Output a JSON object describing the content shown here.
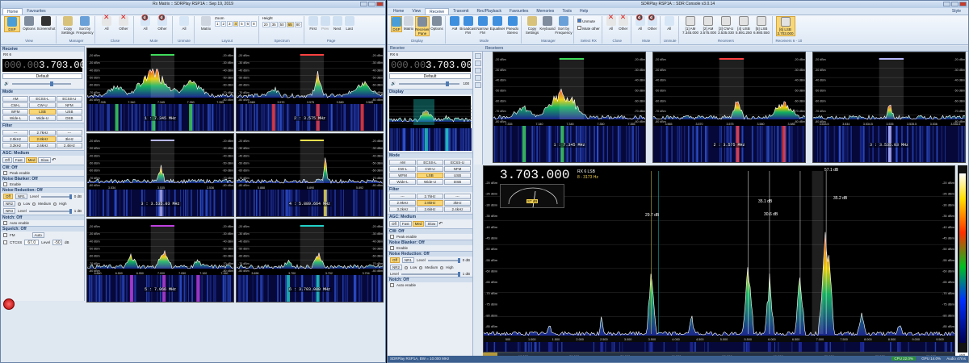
{
  "left_window": {
    "title": "Rx Matrix :: SDRPlay RSP1A :: Sep 19, 2019",
    "tabs": [
      "Home",
      "Favourites"
    ],
    "ribbon": {
      "groups": [
        {
          "caption": "View",
          "buttons": [
            "DSP",
            "Options",
            "Screenshot"
          ]
        },
        {
          "caption": "Manager",
          "buttons": [
            "Copy Settings",
            "Sort by Frequency"
          ]
        },
        {
          "caption": "Close",
          "buttons": [
            "All",
            "Other"
          ]
        },
        {
          "caption": "Mute",
          "buttons": [
            "All",
            "Other"
          ]
        },
        {
          "caption": "Unmute",
          "buttons": [
            "All"
          ]
        },
        {
          "caption": "Layout",
          "buttons": [
            "Matrix"
          ],
          "zoom_label": "Zoom",
          "zoom_values": [
            "1",
            "2",
            "3",
            "4",
            "5",
            "6",
            "8"
          ]
        },
        {
          "caption": "Spectrum",
          "height_label": "Height",
          "height_values": [
            "20",
            "35",
            "50",
            "65",
            "80"
          ]
        },
        {
          "caption": "Page",
          "buttons": [
            "First",
            "Prev",
            "Next",
            "Last"
          ]
        }
      ]
    },
    "panel": {
      "receive_label": "Receive",
      "rx_header": "RX 6",
      "freq_dim": "000.00",
      "freq_main": "3.703.000",
      "preset": "Default",
      "mode_label": "Mode",
      "modes": [
        "AM",
        "ECSS-L",
        "ECSS-U",
        "CW-L",
        "CW-U",
        "NFM",
        "WFM",
        "LSB",
        "USB",
        "Wide-L",
        "Wide-U",
        "DSB"
      ],
      "filter_label": "Filter",
      "filters": [
        "---",
        "2.7kHz",
        "---",
        "2.9kHz",
        "2.8kHz",
        "3kHz",
        "3.2kHz",
        "2.6kHz",
        "2.4kHz"
      ],
      "agc_label": "AGC: Medium",
      "agc_buttons": [
        "Off",
        "Fast",
        "Med",
        "Slow"
      ],
      "cw_off": "CW: Off",
      "peak_enable": "Peak enable",
      "noise_blanker": "Noise Blanker: Off",
      "enable": "Enable",
      "noise_reduction": "Noise Reduction: Off",
      "nr_off": "Off",
      "nr1": "NR1",
      "nr2": "NR2",
      "nr3": "NR3",
      "level": "Level",
      "low": "Low",
      "medium": "Medium",
      "high": "High",
      "db1": "0 dB",
      "db2": "1 dB",
      "notch_off": "Notch: Off",
      "auto_enable": "Auto enable",
      "squelch_off": "Squelch: Off",
      "fm": "FM",
      "ctcss": "CTCSS",
      "ctcss_value": "67.0",
      "squelch_level": "Level",
      "squelch_db": "dB"
    },
    "cells": [
      {
        "rx": "1",
        "freq": "1 : 7.345 MHz",
        "hdr_f": "8 - 7173 Hz",
        "ticks": [
          "7.335",
          "7.340",
          "7.345",
          "7.350",
          "7.355"
        ]
      },
      {
        "rx": "2",
        "freq": "2 : 3.575 MHz",
        "hdr_f": "8 - 3173 Hz",
        "ticks": [
          "3.565",
          "3.570",
          "3.575",
          "3.580",
          "3.585"
        ]
      },
      {
        "rx": "3",
        "freq": "3 : 3.535.03 MHz",
        "hdr_f": "8 - 3173 Hz",
        "ticks": [
          "3.534",
          "3.535",
          "3.536"
        ]
      },
      {
        "rx": "4",
        "freq": "4 : 5.889.664 MHz",
        "hdr_f": "8 - 3173 Hz",
        "ticks": [
          "5.888",
          "5.890",
          "5.892"
        ]
      },
      {
        "rx": "5",
        "freq": "5 : 7.066 MHz",
        "hdr_f": "8 - 3173 Hz",
        "ticks": [
          "6.850",
          "6.900",
          "6.950",
          "7.000",
          "7.050",
          "7.100",
          "7.150"
        ]
      },
      {
        "rx": "6",
        "freq": "6 : 3.703.000 MHz",
        "hdr_f": "8 - 3173 Hz",
        "ticks": [
          "3.698",
          "3.700",
          "3.702",
          "3.704"
        ]
      }
    ],
    "db_ticks": [
      "-20 dBm",
      "-30 dBm",
      "-40 dBm",
      "-50 dBm",
      "-60 dBm",
      "-70 dBm",
      "-80 dBm"
    ]
  },
  "right_window": {
    "title": "SDRPlay RSP1A :: SDR Console v3.0.14",
    "tabs": [
      "Home",
      "View",
      "Receive",
      "Transmit",
      "Rec/Playback",
      "Favourites",
      "Memories",
      "Tools",
      "Help"
    ],
    "style_label": "Style",
    "ribbon": {
      "groups": [
        {
          "caption": "Display",
          "buttons": [
            "DSP",
            "Matrix",
            "Receiver Pane",
            "Options"
          ]
        },
        {
          "caption": "Mode",
          "buttons": [
            "AM",
            "Broadcast FM",
            "Narrow FM",
            "Equaliser",
            "Pseudo Stereo"
          ]
        },
        {
          "caption": "Manager",
          "buttons": [
            "Copy Settings",
            "Keyboard",
            "Sort by Frequency"
          ]
        },
        {
          "caption": "Select RX",
          "checks": [
            "Unmute",
            "Mute other"
          ]
        },
        {
          "caption": "Close",
          "buttons": [
            "All",
            "Other"
          ]
        },
        {
          "caption": "Mute",
          "buttons": [
            "All",
            "Other"
          ]
        },
        {
          "caption": "Unmute",
          "buttons": [
            "All"
          ]
        },
        {
          "caption": "Receivers",
          "buttons": [
            "[1] AM 7.345.000",
            "[2] AM 3.575.000",
            "[3] CW-U 3.535.030",
            "[4] USB 5.891.250",
            "[5] LSB 6.980.550"
          ]
        },
        {
          "caption": "Receivers 6 - 10",
          "buttons": [
            "[6] LSB 3.703.000"
          ]
        }
      ]
    },
    "panel": {
      "receive_label": "Receive",
      "receivers_label": "Receivers",
      "rx_header": "RX 6",
      "freq_dim": "000.00",
      "freq_main": "3.703.000",
      "preset": "Default",
      "vol_value": "100",
      "display_label": "Display",
      "mode_label": "Mode",
      "modes": [
        "AM",
        "ECSS-L",
        "ECSS-U",
        "CW-L",
        "CW-U",
        "NFM",
        "WFM",
        "LSB",
        "USB",
        "Wide-L",
        "Wide-U",
        "DSB"
      ],
      "filter_label": "Filter",
      "filters": [
        "---",
        "2.7kHz",
        "---",
        "2.9kHz",
        "2.8kHz",
        "3kHz",
        "3.2kHz",
        "2.6kHz",
        "2.4kHz"
      ],
      "agc_label": "AGC: Medium",
      "agc_buttons": [
        "Off",
        "Fast",
        "Med",
        "Slow"
      ],
      "cw_off": "CW: Off",
      "peak_enable": "Peak enable",
      "noise_blanker": "Noise Blanker: Off",
      "enable": "Enable",
      "noise_reduction": "Noise Reduction: Off",
      "nr_off": "Off",
      "nr1": "NR1",
      "nr2": "NR2",
      "level": "Level",
      "low": "Low",
      "medium": "Medium",
      "high": "High",
      "db1": "0 dB",
      "db2": "1 dB",
      "notch_off": "Notch: Off",
      "auto_enable": "Auto enable"
    },
    "mini_cells": [
      {
        "freq": "1 : 7.345 MHz",
        "ticks": [
          "7.335",
          "7.340",
          "7.345",
          "7.350",
          "7.355"
        ]
      },
      {
        "freq": "2 : 3.575 MHz",
        "ticks": [
          "3.565",
          "3.570",
          "3.575",
          "3.580",
          "3.585"
        ]
      },
      {
        "freq": "3 : 3.535.03 MHz",
        "ticks": [
          "3.533.5",
          "3.534",
          "3.534.5",
          "3.535",
          "3.535.5",
          "3.536",
          "3.536.5"
        ]
      }
    ],
    "main": {
      "freq": "3.703.000",
      "rx_mode": "RX 6  LSB",
      "hdr_f": "8 - 3173 Hz",
      "smeter_value": "S7 dB",
      "peaks": [
        "57.1 dB",
        "35.1 dB",
        "35.2 dB",
        "30.6 dB",
        "29.7 dB"
      ],
      "db_ticks": [
        "-20 dBm",
        "-25 dBm",
        "-30 dBm",
        "-35 dBm",
        "-40 dBm",
        "-45 dBm",
        "-50 dBm",
        "-55 dBm",
        "-60 dBm",
        "-65 dBm",
        "-70 dBm",
        "-75 dBm",
        "-80 dBm",
        "-85 dBm"
      ],
      "x_ticks": [
        "500",
        "1.000",
        "1.500",
        "2.000",
        "2.500",
        "3.000",
        "3.500",
        "4.000",
        "4.500",
        "5.000",
        "5.500",
        "6.000",
        "6.500",
        "7.000",
        "7.500",
        "8.000",
        "8.500",
        "9.000",
        "9.500"
      ],
      "overview_ticks": [
        "10.000",
        "20.000",
        "30.000",
        "40.000",
        "50.000",
        "60.000",
        "70.000",
        "80.000",
        "90.000"
      ],
      "zoom_select": "x50"
    },
    "status": {
      "left": "SDRPlay RSP1A, BW = 10.000 MHz",
      "cpu": "CPU 22.0%",
      "gpu": "GPU 14.0%",
      "audio": "Audio 47ms"
    }
  }
}
